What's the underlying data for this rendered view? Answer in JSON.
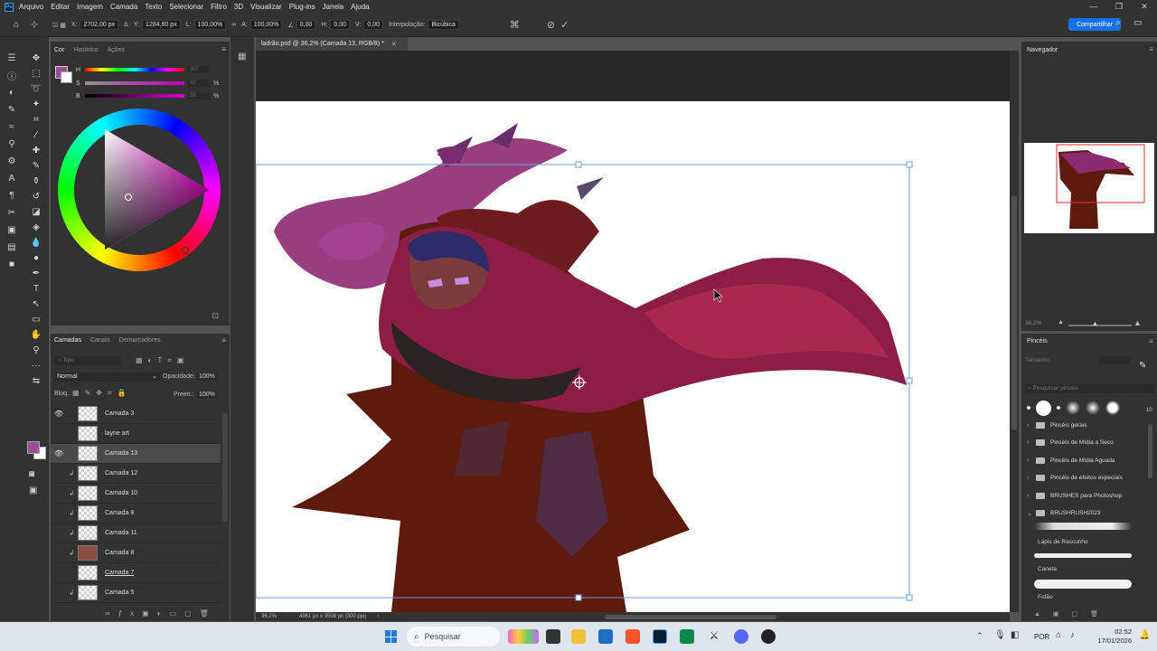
{
  "app": {
    "logo": "Ps"
  },
  "menu": [
    "Arquivo",
    "Editar",
    "Imagem",
    "Camada",
    "Texto",
    "Selecionar",
    "Filtro",
    "3D",
    "Visualizar",
    "Plug-ins",
    "Janela",
    "Ajuda"
  ],
  "window_controls": [
    "—",
    "❐",
    "✕"
  ],
  "options": {
    "x_label": "X:",
    "x_value": "2702,00 px",
    "y_label": "Y:",
    "y_value": "1284,60 px",
    "w_label": "L:",
    "w_value": "100,00%",
    "h_label": "A:",
    "h_value": "100,00%",
    "angle_value": "0,00",
    "hskew_label": "H:",
    "hskew_value": "0,00",
    "vskew_label": "V:",
    "vskew_value": "0,00",
    "interp_label": "Interpolação:",
    "interp_value": "Bicúbica",
    "share_label": "Compartilhar"
  },
  "color_panel": {
    "tabs": [
      "Cor",
      "Histórico",
      "Ações"
    ],
    "h_label": "H",
    "h_value": "307",
    "s_label": "S",
    "s_value": "42",
    "b_label": "B",
    "b_value": "58",
    "pct": "%",
    "fg_color": "#9a4e96",
    "bg_color": "#ffffff"
  },
  "layers_panel": {
    "tabs": [
      "Camadas",
      "Canais",
      "Demarcadores"
    ],
    "search_placeholder": "Tipo",
    "blend_mode": "Normal",
    "opacity_label": "Opacidade:",
    "opacity_value": "100%",
    "lock_label": "Bloq.:",
    "fill_label": "Preen.:",
    "fill_value": "100%",
    "layers": [
      {
        "name": "Camada 3",
        "visible": true,
        "clip": false,
        "selected": false
      },
      {
        "name": "layne art",
        "visible": false,
        "clip": false,
        "selected": false
      },
      {
        "name": "Camada 13",
        "visible": true,
        "clip": false,
        "selected": true
      },
      {
        "name": "Camada 12",
        "visible": false,
        "clip": true,
        "selected": false
      },
      {
        "name": "Camada 10",
        "visible": false,
        "clip": true,
        "selected": false
      },
      {
        "name": "Camada 9",
        "visible": false,
        "clip": true,
        "selected": false
      },
      {
        "name": "Camada 11",
        "visible": false,
        "clip": true,
        "selected": false
      },
      {
        "name": "Camada 8",
        "visible": false,
        "clip": true,
        "selected": false
      },
      {
        "name": "Camada 7",
        "visible": false,
        "clip": false,
        "selected": false
      },
      {
        "name": "Camada 5",
        "visible": false,
        "clip": true,
        "selected": false
      }
    ]
  },
  "document": {
    "tab_title": "ladrão.psd @ 36,2% (Camada 13, RGB/8) *",
    "zoom": "36,2%",
    "doc_info": "4961 px x 3508 px (300 ppi)"
  },
  "navigator": {
    "title": "Navegador",
    "zoom": "36,2%"
  },
  "brushes_panel": {
    "title": "Pincéis",
    "size_label": "Tamanho:",
    "search_placeholder": "Pesquisar pincéis",
    "preset_size": "10",
    "folders": [
      "Pincéis gerais",
      "Pincéis de Mídia a Seco",
      "Pincéis de Mídia Aguada",
      "Pincéis de efeitos especiais",
      "BRUSHES para Photoshop",
      "BRUSHRUSH2023"
    ],
    "brushes": [
      "Lápis de Rascunho",
      "Caneta",
      "Fofão"
    ]
  },
  "taskbar": {
    "search_label": "Pesquisar",
    "lang": "POR",
    "time": "02:52",
    "date": "17/01/2026"
  },
  "colors": {
    "cloak": "#5e1a0c",
    "hood": "#8c1d45",
    "purple_wing": "#8e2a72",
    "accent_blue": "#1473e6"
  }
}
